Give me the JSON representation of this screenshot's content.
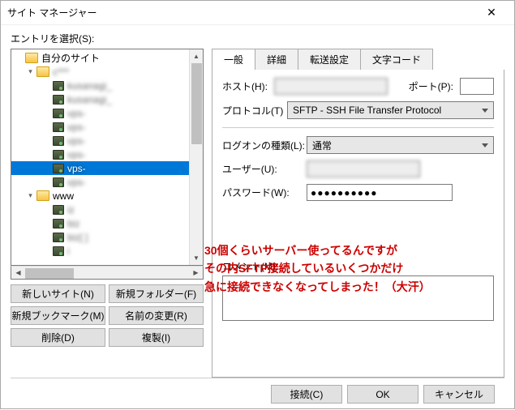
{
  "window": {
    "title": "サイト マネージャー"
  },
  "labels": {
    "select_entry": "エントリを選択(S):",
    "host": "ホスト(H):",
    "port": "ポート(P):",
    "protocol": "プロトコル(T)",
    "logon_type": "ログオンの種類(L):",
    "user": "ユーザー(U):",
    "password": "パスワード(W):",
    "comment": "コメント(M):"
  },
  "tree": {
    "root": "自分のサイト",
    "node1_blur": "c***",
    "items1": [
      "kusanagi_",
      "kusanagi_",
      "vps-",
      "vps-",
      "vps-",
      "vps-",
      "vps-",
      "vps-"
    ],
    "selected_index": 6,
    "node2": "www",
    "items2": [
      "iz",
      "biz",
      "biz[         ]",
      "i"
    ]
  },
  "buttons": {
    "new_site": "新しいサイト(N)",
    "new_folder": "新規フォルダー(F)",
    "new_bookmark": "新規ブックマーク(M)",
    "rename": "名前の変更(R)",
    "delete": "削除(D)",
    "duplicate": "複製(I)"
  },
  "tabs": {
    "general": "一般",
    "advanced": "詳細",
    "transfer": "転送設定",
    "charset": "文字コード"
  },
  "form": {
    "host_value": "",
    "port_value": "",
    "protocol_value": "SFTP - SSH File Transfer Protocol",
    "logon_value": "通常",
    "user_value": "",
    "password_mask": "●●●●●●●●●●"
  },
  "overlay": {
    "l1": "30個くらいサーバー使ってるんですが",
    "l2": "その内SFTP接続しているいくつかだけ",
    "l3": "急に接続できなくなってしまった！（大汗）"
  },
  "footer": {
    "connect": "接続(C)",
    "ok": "OK",
    "cancel": "キャンセル"
  }
}
